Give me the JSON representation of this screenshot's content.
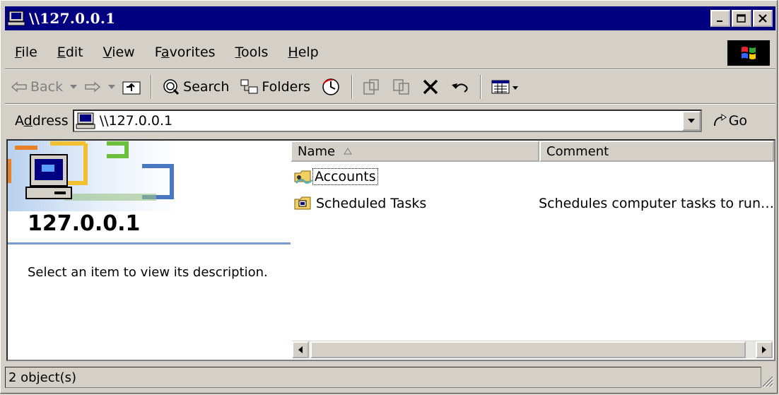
{
  "window": {
    "title": "\\\\127.0.0.1"
  },
  "menu": {
    "items": [
      {
        "pre": "",
        "key": "F",
        "post": "ile"
      },
      {
        "pre": "",
        "key": "E",
        "post": "dit"
      },
      {
        "pre": "",
        "key": "V",
        "post": "iew"
      },
      {
        "pre": "F",
        "key": "a",
        "post": "vorites"
      },
      {
        "pre": "",
        "key": "T",
        "post": "ools"
      },
      {
        "pre": "",
        "key": "H",
        "post": "elp"
      }
    ]
  },
  "toolbar": {
    "back_label": "Back",
    "search_label": "Search",
    "folders_label": "Folders"
  },
  "address": {
    "label_pre": "A",
    "label_key": "d",
    "label_post": "dress",
    "value": "\\\\127.0.0.1",
    "go_label": "Go"
  },
  "leftpane": {
    "computer_name": "127.0.0.1",
    "description": "Select an item to view its description."
  },
  "columns": {
    "name": "Name",
    "comment": "Comment"
  },
  "items": [
    {
      "name": "Accounts",
      "comment": ""
    },
    {
      "name": "Scheduled Tasks",
      "comment": "Schedules computer tasks to run…"
    }
  ],
  "status": {
    "text": "2 object(s)"
  },
  "colors": {
    "titlebar": "#000080",
    "chrome": "#d4d0c8",
    "pane_rule": "#7a9ccc"
  }
}
